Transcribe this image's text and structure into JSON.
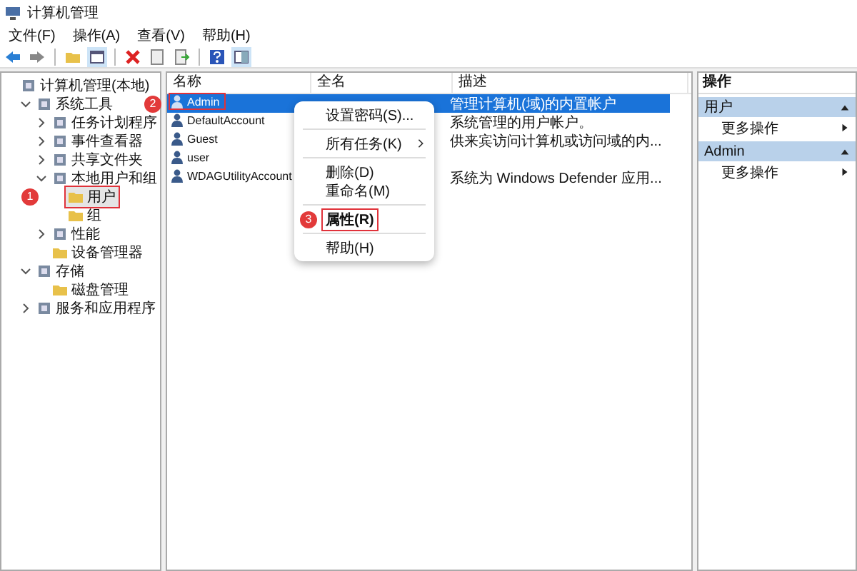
{
  "window": {
    "title": "计算机管理"
  },
  "menu": [
    "文件(F)",
    "操作(A)",
    "查看(V)",
    "帮助(H)"
  ],
  "tree": [
    {
      "label": "计算机管理(本地)",
      "selected": false,
      "children": [
        {
          "label": "系统工具",
          "selected": false,
          "expanded": true,
          "children": [
            {
              "label": "任务计划程序",
              "selected": false,
              "expanded": false
            },
            {
              "label": "事件查看器",
              "selected": false,
              "expanded": false
            },
            {
              "label": "共享文件夹",
              "selected": false,
              "expanded": false
            },
            {
              "label": "本地用户和组",
              "selected": false,
              "expanded": true,
              "children": [
                {
                  "label": "用户",
                  "selected": true,
                  "badge": "1"
                },
                {
                  "label": "组",
                  "selected": false
                }
              ]
            },
            {
              "label": "性能",
              "selected": false,
              "expanded": false
            },
            {
              "label": "设备管理器",
              "selected": false
            }
          ]
        },
        {
          "label": "存储",
          "selected": false,
          "expanded": true,
          "children": [
            {
              "label": "磁盘管理",
              "selected": false
            }
          ]
        },
        {
          "label": "服务和应用程序",
          "selected": false,
          "expanded": false
        }
      ]
    }
  ],
  "table": {
    "columns": [
      "名称",
      "全名",
      "描述"
    ],
    "rows": [
      {
        "name": "Admin",
        "description": "管理计算机(域)的内置帐户",
        "selected": true,
        "badge": "2"
      },
      {
        "name": "DefaultAccount",
        "description": "系统管理的用户帐户。",
        "selected": false
      },
      {
        "name": "Guest",
        "description": "供来宾访问计算机或访问域的内...",
        "selected": false
      },
      {
        "name": "user",
        "selected": false
      },
      {
        "name": "WDAGUtilityAccount",
        "description": "系统为 Windows Defender 应用...",
        "selected": false
      }
    ]
  },
  "context_menu": {
    "groups": [
      [
        {
          "label": "设置密码(S)...",
          "submenu": false,
          "default": false
        }
      ],
      [
        {
          "label": "所有任务(K)",
          "submenu": true,
          "default": false
        }
      ],
      [
        {
          "label": "删除(D)",
          "submenu": false,
          "default": false
        },
        {
          "label": "重命名(M)",
          "submenu": false,
          "default": false
        }
      ],
      [
        {
          "label": "属性(R)",
          "submenu": false,
          "default": true,
          "badge": "3"
        }
      ],
      [
        {
          "label": "帮助(H)",
          "submenu": false,
          "default": false
        }
      ]
    ]
  },
  "actions": {
    "title": "操作",
    "sections": [
      {
        "title": "用户",
        "items": [
          "更多操作"
        ]
      },
      {
        "title": "Admin",
        "items": [
          "更多操作"
        ]
      }
    ]
  }
}
